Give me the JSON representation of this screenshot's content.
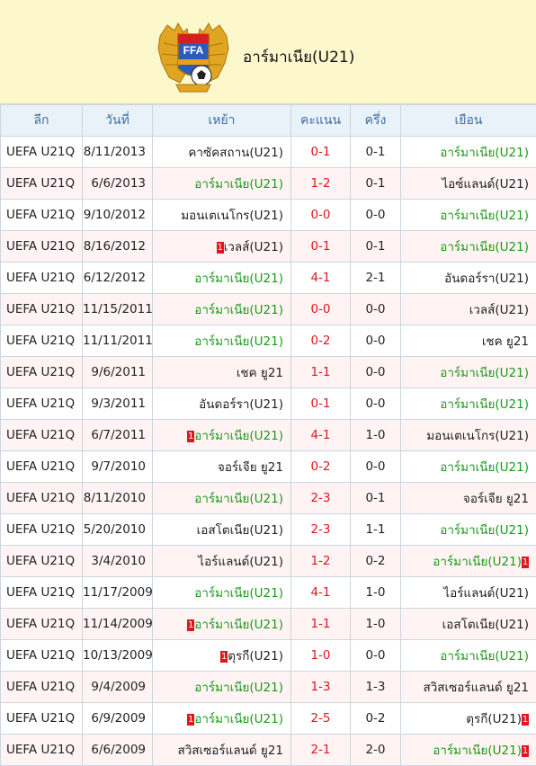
{
  "header": {
    "title": "อาร์มาเนีย(U21)",
    "crest_text": "FFA"
  },
  "colors": {
    "header_bg": "#fcf8cc",
    "table_header_bg": "#eaf2f9",
    "table_header_text": "#3a6fa8",
    "score_red": "#e0161c",
    "team_green": "#1a9a1a",
    "pink_row": "#fff3f3"
  },
  "columns": [
    "ลีก",
    "วันที่",
    "เหย้า",
    "คะแนน",
    "ครึ่ง",
    "เยือน"
  ],
  "matches": [
    {
      "league": "UEFA U21Q",
      "date": "8/11/2013",
      "home": "คาซัคสถาน(U21)",
      "score": "0-1",
      "half": "0-1",
      "away": "อาร์มาเนีย(U21)",
      "home_hl": false,
      "away_hl": true,
      "home_card": "",
      "away_card": "",
      "pink": false
    },
    {
      "league": "UEFA U21Q",
      "date": "6/6/2013",
      "home": "อาร์มาเนีย(U21)",
      "score": "1-2",
      "half": "0-1",
      "away": "ไอซ์แลนด์(U21)",
      "home_hl": true,
      "away_hl": false,
      "home_card": "",
      "away_card": "",
      "pink": true
    },
    {
      "league": "UEFA U21Q",
      "date": "9/10/2012",
      "home": "มอนเตเนโกร(U21)",
      "score": "0-0",
      "half": "0-0",
      "away": "อาร์มาเนีย(U21)",
      "home_hl": false,
      "away_hl": true,
      "home_card": "",
      "away_card": "",
      "pink": false
    },
    {
      "league": "UEFA U21Q",
      "date": "8/16/2012",
      "home": "เวลส์(U21)",
      "score": "0-1",
      "half": "0-1",
      "away": "อาร์มาเนีย(U21)",
      "home_hl": false,
      "away_hl": true,
      "home_card": "1",
      "away_card": "",
      "pink": true
    },
    {
      "league": "UEFA U21Q",
      "date": "6/12/2012",
      "home": "อาร์มาเนีย(U21)",
      "score": "4-1",
      "half": "2-1",
      "away": "อันดอร์รา(U21)",
      "home_hl": true,
      "away_hl": false,
      "home_card": "",
      "away_card": "",
      "pink": false
    },
    {
      "league": "UEFA U21Q",
      "date": "11/15/2011",
      "home": "อาร์มาเนีย(U21)",
      "score": "0-0",
      "half": "0-0",
      "away": "เวลส์(U21)",
      "home_hl": true,
      "away_hl": false,
      "home_card": "",
      "away_card": "",
      "pink": true
    },
    {
      "league": "UEFA U21Q",
      "date": "11/11/2011",
      "home": "อาร์มาเนีย(U21)",
      "score": "0-2",
      "half": "0-0",
      "away": "เชค ยู21",
      "home_hl": true,
      "away_hl": false,
      "home_card": "",
      "away_card": "",
      "pink": false
    },
    {
      "league": "UEFA U21Q",
      "date": "9/6/2011",
      "home": "เชค ยู21",
      "score": "1-1",
      "half": "0-0",
      "away": "อาร์มาเนีย(U21)",
      "home_hl": false,
      "away_hl": true,
      "home_card": "",
      "away_card": "",
      "pink": true
    },
    {
      "league": "UEFA U21Q",
      "date": "9/3/2011",
      "home": "อันดอร์รา(U21)",
      "score": "0-1",
      "half": "0-0",
      "away": "อาร์มาเนีย(U21)",
      "home_hl": false,
      "away_hl": true,
      "home_card": "",
      "away_card": "",
      "pink": false
    },
    {
      "league": "UEFA U21Q",
      "date": "6/7/2011",
      "home": "อาร์มาเนีย(U21)",
      "score": "4-1",
      "half": "1-0",
      "away": "มอนเตเนโกร(U21)",
      "home_hl": true,
      "away_hl": false,
      "home_card": "1",
      "away_card": "",
      "pink": true
    },
    {
      "league": "UEFA U21Q",
      "date": "9/7/2010",
      "home": "จอร์เจีย ยู21",
      "score": "0-2",
      "half": "0-0",
      "away": "อาร์มาเนีย(U21)",
      "home_hl": false,
      "away_hl": true,
      "home_card": "",
      "away_card": "",
      "pink": false
    },
    {
      "league": "UEFA U21Q",
      "date": "8/11/2010",
      "home": "อาร์มาเนีย(U21)",
      "score": "2-3",
      "half": "0-1",
      "away": "จอร์เจีย ยู21",
      "home_hl": true,
      "away_hl": false,
      "home_card": "",
      "away_card": "",
      "pink": true
    },
    {
      "league": "UEFA U21Q",
      "date": "5/20/2010",
      "home": "เอสโตเนีย(U21)",
      "score": "2-3",
      "half": "1-1",
      "away": "อาร์มาเนีย(U21)",
      "home_hl": false,
      "away_hl": true,
      "home_card": "",
      "away_card": "",
      "pink": false
    },
    {
      "league": "UEFA U21Q",
      "date": "3/4/2010",
      "home": "ไอร์แลนด์(U21)",
      "score": "1-2",
      "half": "0-2",
      "away": "อาร์มาเนีย(U21)",
      "home_hl": false,
      "away_hl": true,
      "home_card": "",
      "away_card": "1",
      "pink": true
    },
    {
      "league": "UEFA U21Q",
      "date": "11/17/2009",
      "home": "อาร์มาเนีย(U21)",
      "score": "4-1",
      "half": "1-0",
      "away": "ไอร์แลนด์(U21)",
      "home_hl": true,
      "away_hl": false,
      "home_card": "",
      "away_card": "",
      "pink": false
    },
    {
      "league": "UEFA U21Q",
      "date": "11/14/2009",
      "home": "อาร์มาเนีย(U21)",
      "score": "1-1",
      "half": "1-0",
      "away": "เอสโตเนีย(U21)",
      "home_hl": true,
      "away_hl": false,
      "home_card": "1",
      "away_card": "",
      "pink": true
    },
    {
      "league": "UEFA U21Q",
      "date": "10/13/2009",
      "home": "ตุรกี(U21)",
      "score": "1-0",
      "half": "0-0",
      "away": "อาร์มาเนีย(U21)",
      "home_hl": false,
      "away_hl": true,
      "home_card": "1",
      "away_card": "",
      "pink": false
    },
    {
      "league": "UEFA U21Q",
      "date": "9/4/2009",
      "home": "อาร์มาเนีย(U21)",
      "score": "1-3",
      "half": "1-3",
      "away": "สวิสเซอร์แลนด์ ยู21",
      "home_hl": true,
      "away_hl": false,
      "home_card": "",
      "away_card": "",
      "pink": true
    },
    {
      "league": "UEFA U21Q",
      "date": "6/9/2009",
      "home": "อาร์มาเนีย(U21)",
      "score": "2-5",
      "half": "0-2",
      "away": "ตุรกี(U21)",
      "home_hl": true,
      "away_hl": false,
      "home_card": "1",
      "away_card": "1",
      "pink": false
    },
    {
      "league": "UEFA U21Q",
      "date": "6/6/2009",
      "home": "สวิสเซอร์แลนด์ ยู21",
      "score": "2-1",
      "half": "2-0",
      "away": "อาร์มาเนีย(U21)",
      "home_hl": false,
      "away_hl": true,
      "home_card": "",
      "away_card": "1",
      "pink": true
    }
  ]
}
